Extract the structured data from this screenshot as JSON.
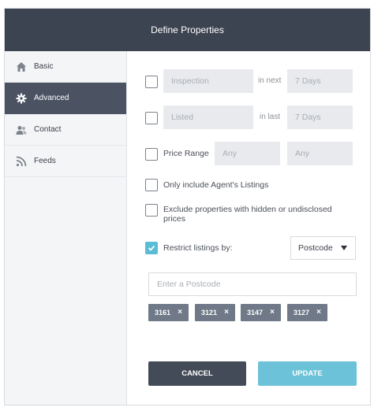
{
  "window": {
    "title": "Define Properties"
  },
  "sidebar": {
    "items": [
      {
        "label": "Basic",
        "icon": "home-icon",
        "active": false
      },
      {
        "label": "Advanced",
        "icon": "gear-icon",
        "active": true
      },
      {
        "label": "Contact",
        "icon": "contacts-icon",
        "active": false
      },
      {
        "label": "Feeds",
        "icon": "rss-icon",
        "active": false
      }
    ]
  },
  "form": {
    "inspection": {
      "placeholder": "Inspection",
      "connector": "in next",
      "period": "7 Days",
      "checked": false
    },
    "listed": {
      "placeholder": "Listed",
      "connector": "in last",
      "period": "7 Days",
      "checked": false
    },
    "price_range": {
      "label": "Price Range",
      "min": "Any",
      "max": "Any",
      "checked": false
    },
    "agent_only": {
      "label": "Only include Agent's Listings",
      "checked": false
    },
    "exclude_hidden": {
      "label_line1": "Exclude properties with hidden or undisclosed",
      "label_line2": "prices",
      "checked": false
    },
    "restrict": {
      "label": "Restrict listings by:",
      "selected": "Postcode",
      "checked": true
    },
    "postcode_input": {
      "placeholder": "Enter a Postcode"
    },
    "tags": [
      "3161",
      "3121",
      "3147",
      "3127"
    ],
    "tag_remove": "×"
  },
  "buttons": {
    "cancel": "CANCEL",
    "update": "UPDATE"
  },
  "colors": {
    "header": "#3d4451",
    "active_nav": "#4b5363",
    "accent": "#5bbcd6",
    "tag": "#6f7988",
    "cancel": "#444b58"
  }
}
